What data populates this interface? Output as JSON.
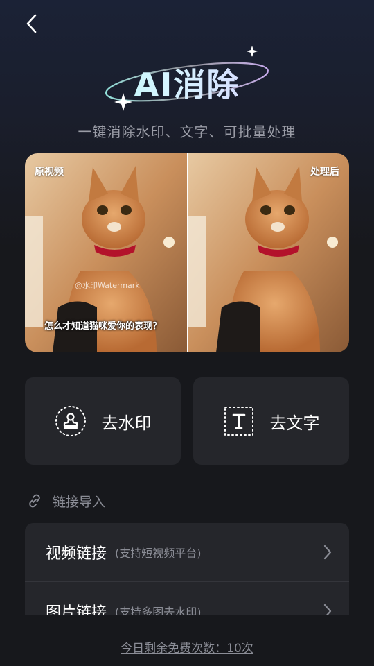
{
  "header": {
    "back_icon": "chevron-left-icon",
    "title": "AI消除",
    "subtitle": "一键消除水印、文字、可批量处理"
  },
  "comparison": {
    "before_label": "原视频",
    "after_label": "处理后",
    "watermark_text": "@水印Watermark",
    "caption_text": "怎么才知道猫咪爱你的表现？"
  },
  "actions": [
    {
      "label": "去水印",
      "icon": "stamp-icon"
    },
    {
      "label": "去文字",
      "icon": "text-box-icon"
    }
  ],
  "link_import": {
    "icon": "link-icon",
    "label": "链接导入",
    "items": [
      {
        "title": "视频链接",
        "hint": "(支持短视频平台)"
      },
      {
        "title": "图片链接",
        "hint": "(支持多图去水印)"
      }
    ]
  },
  "footer": {
    "free_count_text": "今日剩余免费次数：10次"
  },
  "colors": {
    "background": "#17181c",
    "card": "#25262b",
    "title_gradient_start": "#9ff7ee",
    "title_gradient_end": "#d8b8ff",
    "muted_text": "#8b8d96"
  }
}
